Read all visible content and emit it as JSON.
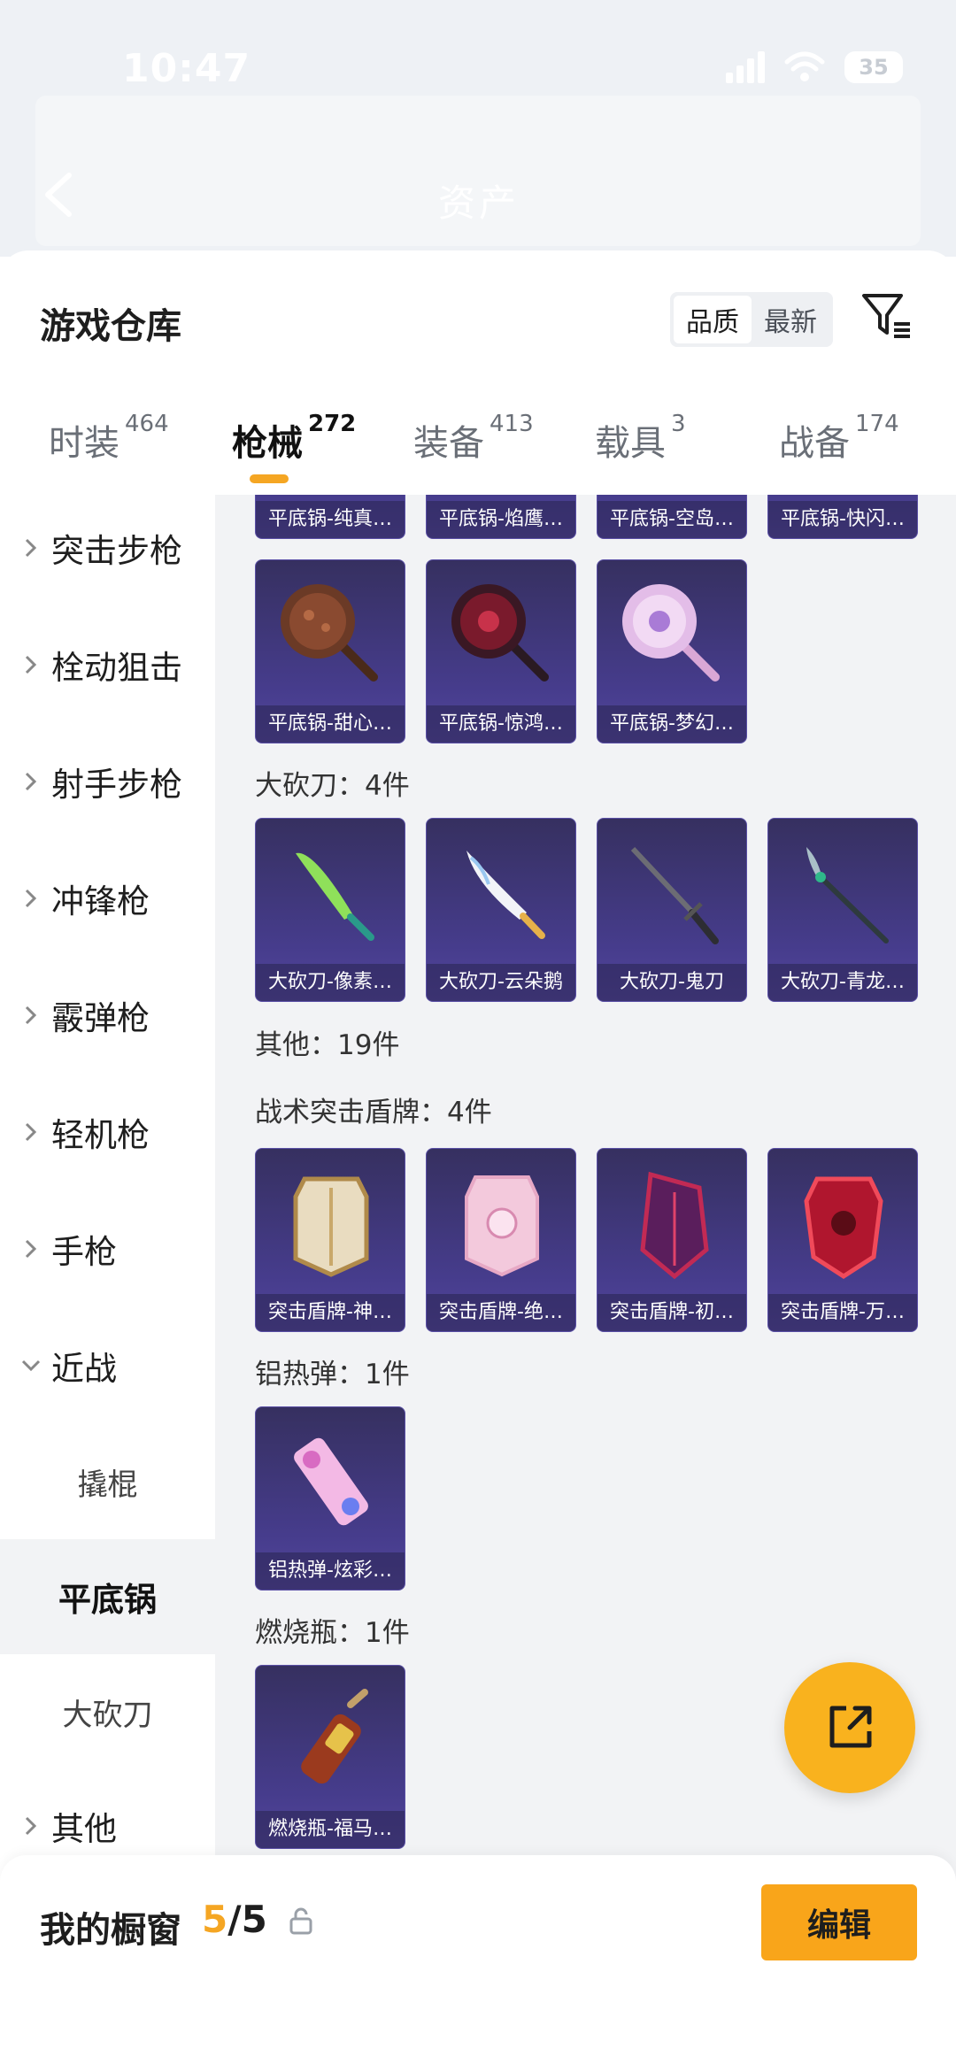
{
  "status_bar": {
    "time": "10:47",
    "battery": "35"
  },
  "nav": {
    "title": "资产"
  },
  "sheet": {
    "title": "游戏仓库"
  },
  "sort": {
    "options": [
      "品质",
      "最新"
    ],
    "active": "品质"
  },
  "tabs": [
    {
      "label": "时装",
      "count": "464"
    },
    {
      "label": "枪械",
      "count": "272"
    },
    {
      "label": "装备",
      "count": "413"
    },
    {
      "label": "载具",
      "count": "3"
    },
    {
      "label": "战备",
      "count": "174"
    }
  ],
  "sidebar": {
    "items": [
      "突击步枪",
      "栓动狙击",
      "射手步枪",
      "冲锋枪",
      "霰弹枪",
      "轻机枪",
      "手枪",
      "近战"
    ],
    "sub_items": [
      "撬棍",
      "平底锅",
      "大砍刀"
    ],
    "active_sub": "平底锅",
    "last_item": "其他"
  },
  "content": {
    "top_partial": [
      "平底锅-纯真…",
      "平底锅-焰鹰…",
      "平底锅-空岛…",
      "平底锅-快闪…"
    ],
    "pan_row2": [
      "平底锅-甜心…",
      "平底锅-惊鸿…",
      "平底锅-梦幻…"
    ],
    "machete_title": "大砍刀：4件",
    "machete": [
      "大砍刀-像素…",
      "大砍刀-云朵鹅",
      "大砍刀-鬼刀",
      "大砍刀-青龙…"
    ],
    "other_title": "其他：19件",
    "shield_title": "战术突击盾牌：4件",
    "shield": [
      "突击盾牌-神…",
      "突击盾牌-绝…",
      "突击盾牌-初…",
      "突击盾牌-万…"
    ],
    "thermite_title": "铝热弹：1件",
    "thermite": [
      "铝热弹-炫彩…"
    ],
    "molotov_title": "燃烧瓶：1件",
    "molotov": [
      "燃烧瓶-福马…"
    ]
  },
  "showcase": {
    "label": "我的橱窗",
    "current": "5",
    "total": "/5",
    "edit_label": "编辑"
  },
  "colors": {
    "accent": "#f5a623",
    "card_bg": "#463c8c",
    "panel_bg": "#f2f3f5"
  }
}
